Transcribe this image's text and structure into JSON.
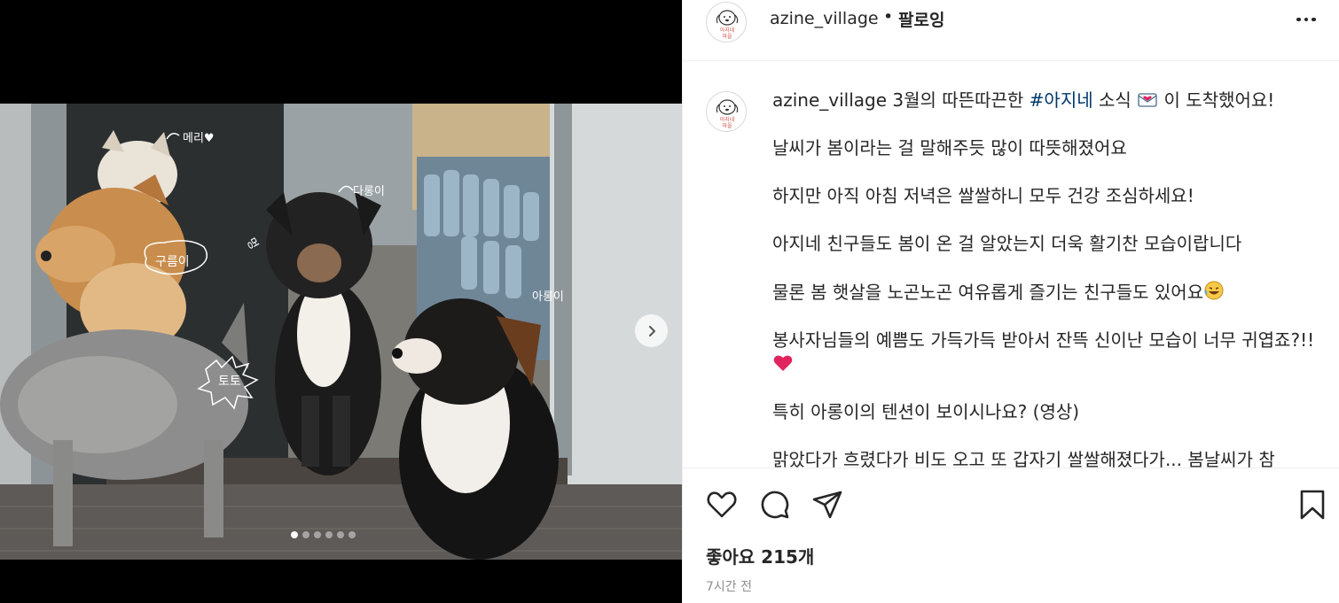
{
  "post": {
    "username": "azine_village",
    "follow_label": "팔로잉",
    "separator": "•",
    "avatar_text": "아지네 마을",
    "caption": {
      "username": "azine_village",
      "first_line_before": "3월의 따뜬따끈한",
      "hashtag": "#아지네",
      "first_line_after": "소식",
      "first_line_end": "이 도착했어요!",
      "paragraphs": [
        "날씨가 봄이라는 걸 말해주듯 많이 따뜻해졌어요",
        "하지만 아직 아침 저녁은 쌀쌀하니 모두 건강 조심하세요!",
        "아지네 친구들도 봄이 온 걸 알았는지 더욱 활기찬 모습이랍니다",
        "물론 봄 햇살을 노곤노곤 여유롭게 즐기는 친구들도 있어요",
        "봉사자님들의 예쁨도 가득가득 받아서 잔뜩 신이난 모습이 너무 귀엽죠?!!",
        "특히 아롱이의 텐션이 보이시나요? (영상)",
        "맑았다가 흐렸다가 비도 오고 또 갑자기 쌀쌀해졌다가... 봄날씨가 참"
      ]
    },
    "likes_text": "좋아요 215개",
    "time_text": "7시간 전",
    "carousel": {
      "count": 6,
      "active": 0
    },
    "photo_labels": {
      "meri": "메리♥",
      "darongi": "다롱이",
      "meong": "멍",
      "gureumi": "구름이",
      "arongi": "아롱이",
      "toto": "토토"
    }
  },
  "icons": {
    "like": "heart-icon",
    "comment": "comment-icon",
    "share": "paper-plane-icon",
    "save": "bookmark-icon",
    "more": "more-options-icon",
    "next": "chevron-right-icon"
  },
  "colors": {
    "hashtag": "#00376b",
    "meta": "#8e8e8e",
    "heart": "#e0245e"
  }
}
